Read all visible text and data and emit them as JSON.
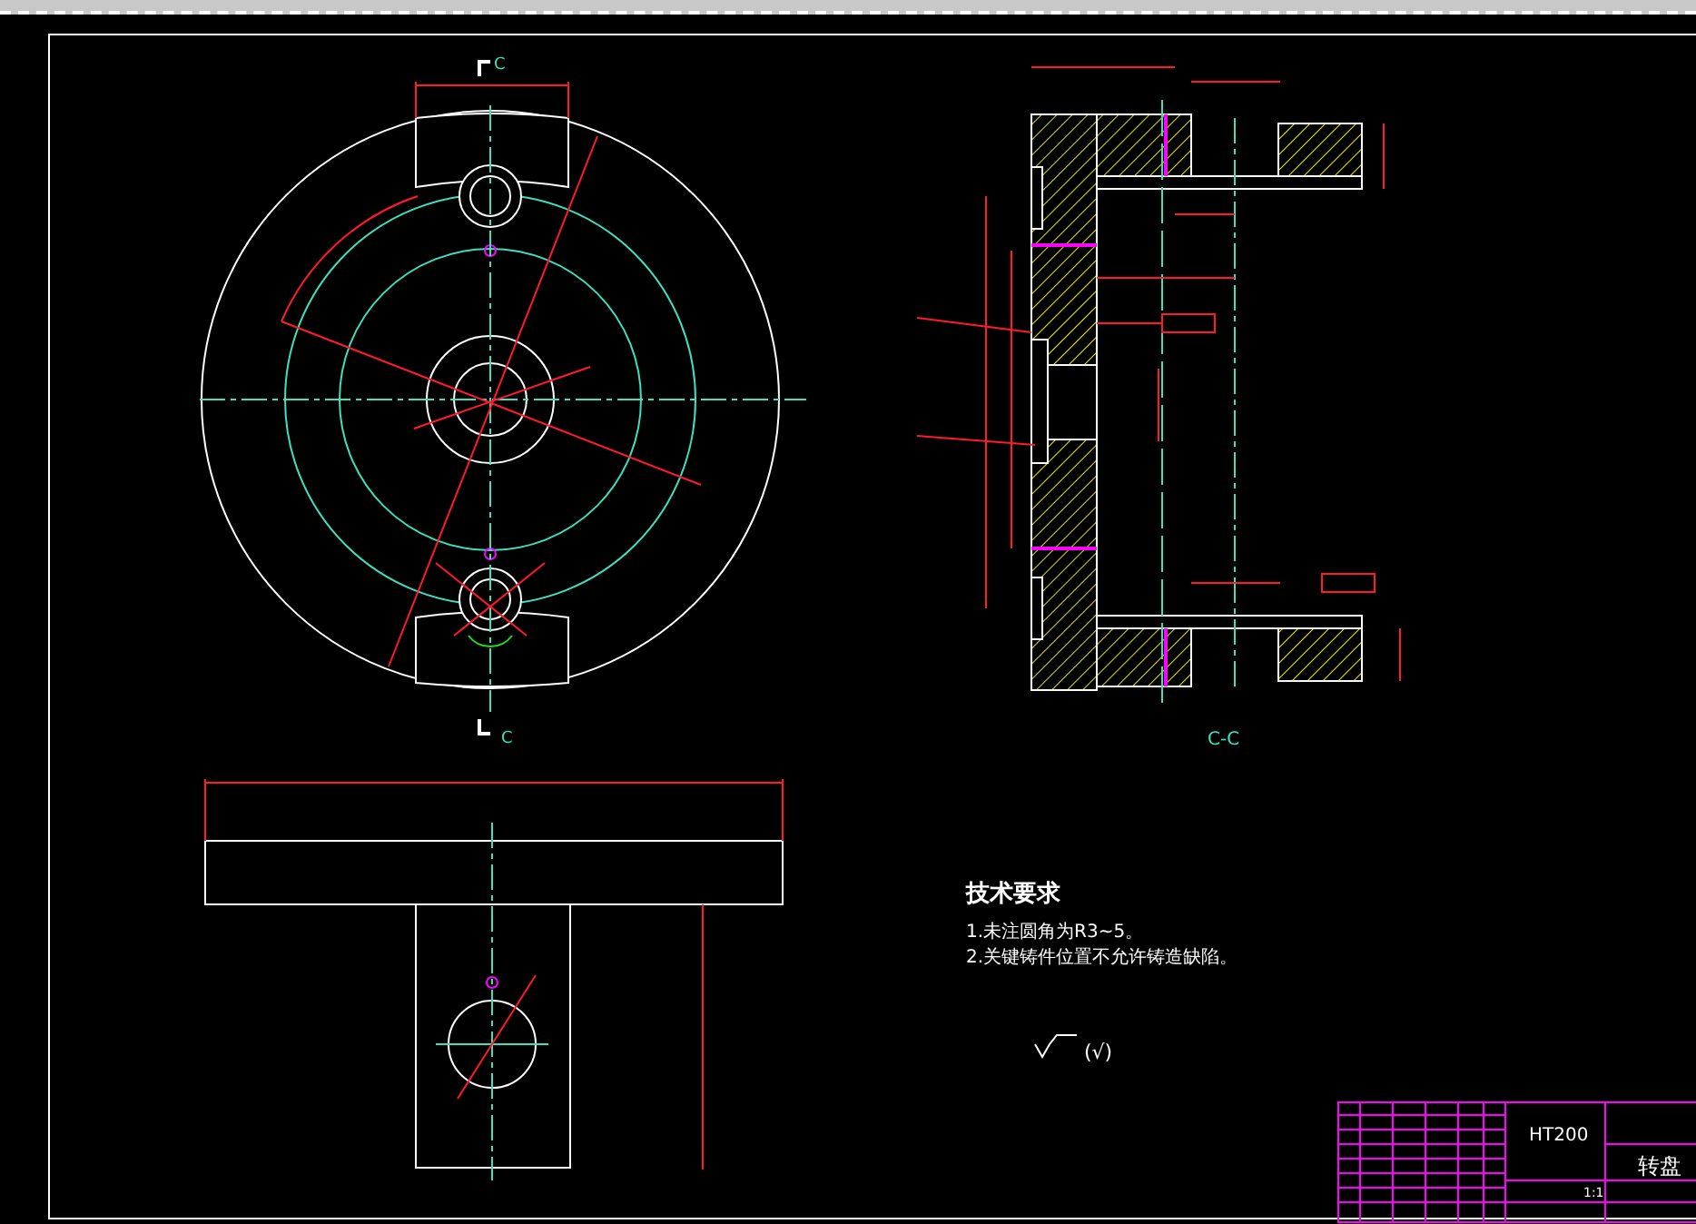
{
  "drawing": {
    "section_marks": [
      "C",
      "C"
    ],
    "section_title": "C-C"
  },
  "technical_requirements": {
    "title": "技术要求",
    "items": [
      "1.未注圆角为R3~5。",
      "2.关键铸件位置不允许铸造缺陷。"
    ]
  },
  "roughness_note": "(√)",
  "title_block": {
    "material": "HT200",
    "part_name": "转盘",
    "scale": "1:1"
  }
}
